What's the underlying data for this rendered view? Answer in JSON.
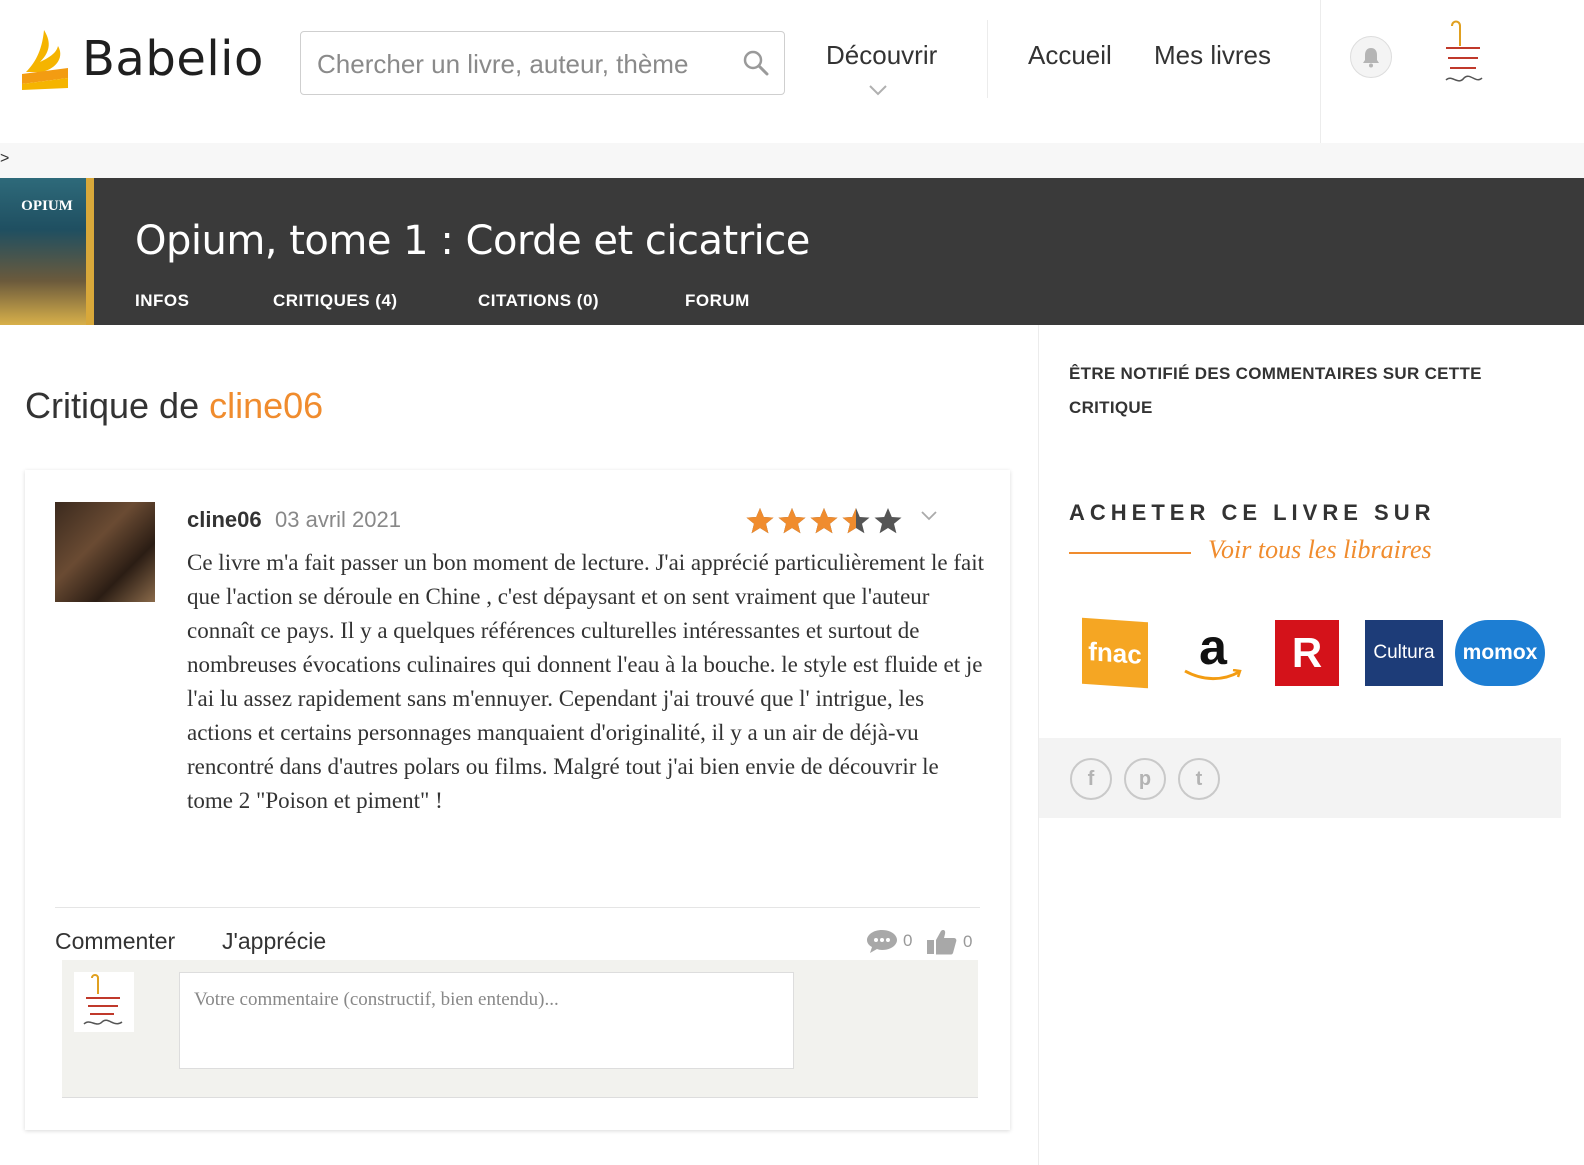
{
  "header": {
    "logo_text": "Babelio",
    "search_placeholder": "Chercher un livre, auteur, thème",
    "nav": {
      "discover": "Découvrir",
      "home": "Accueil",
      "my_books": "Mes livres"
    }
  },
  "breadcrumb": ">",
  "book": {
    "cover_title": "OPIUM",
    "title": "Opium, tome 1 : Corde et cicatrice",
    "tabs": [
      "INFOS",
      "CRITIQUES (4)",
      "CITATIONS (0)",
      "FORUM"
    ]
  },
  "critique": {
    "heading_prefix": "Critique de ",
    "heading_user": "cline06",
    "review": {
      "user": "cline06",
      "date": "03 avril 2021",
      "rating": 3.5,
      "rating_max": 5,
      "body": "Ce livre m'a fait passer un bon moment de lecture. J'ai apprécié particulièrement le fait que l'action se déroule en Chine , c'est dépaysant et on sent vraiment que l'auteur connaît ce pays. Il y a quelques références culturelles intéressantes et surtout de nombreuses évocations culinaires qui donnent l'eau à la bouche. le style est fluide et je l'ai lu assez rapidement sans m'ennuyer. Cependant j'ai trouvé que l' intrigue, les actions et certains personnages manquaient d'originalité, il y a un air de déjà-vu rencontré dans d'autres polars ou films. Malgré tout j'ai bien envie de découvrir le tome 2 \"Poison et piment\" !"
    },
    "actions": {
      "comment": "Commenter",
      "like": "J'apprécie"
    },
    "counts": {
      "comments": "0",
      "likes": "0"
    },
    "comment_placeholder": "Votre commentaire (constructif, bien entendu)..."
  },
  "sidebar": {
    "notify": "ÊTRE NOTIFIÉ DES COMMENTAIRES SUR CETTE CRITIQUE",
    "buy_title": "ACHETER CE LIVRE SUR",
    "buy_all": "Voir tous les libraires",
    "shops": [
      "fnac",
      "a",
      "R",
      "Cultura",
      "momox"
    ],
    "share": [
      "f",
      "p",
      "t"
    ]
  },
  "colors": {
    "accent": "#f08c2e",
    "band": "#3a3a3a",
    "star": "#f08c2e",
    "star_empty": "#555555"
  }
}
